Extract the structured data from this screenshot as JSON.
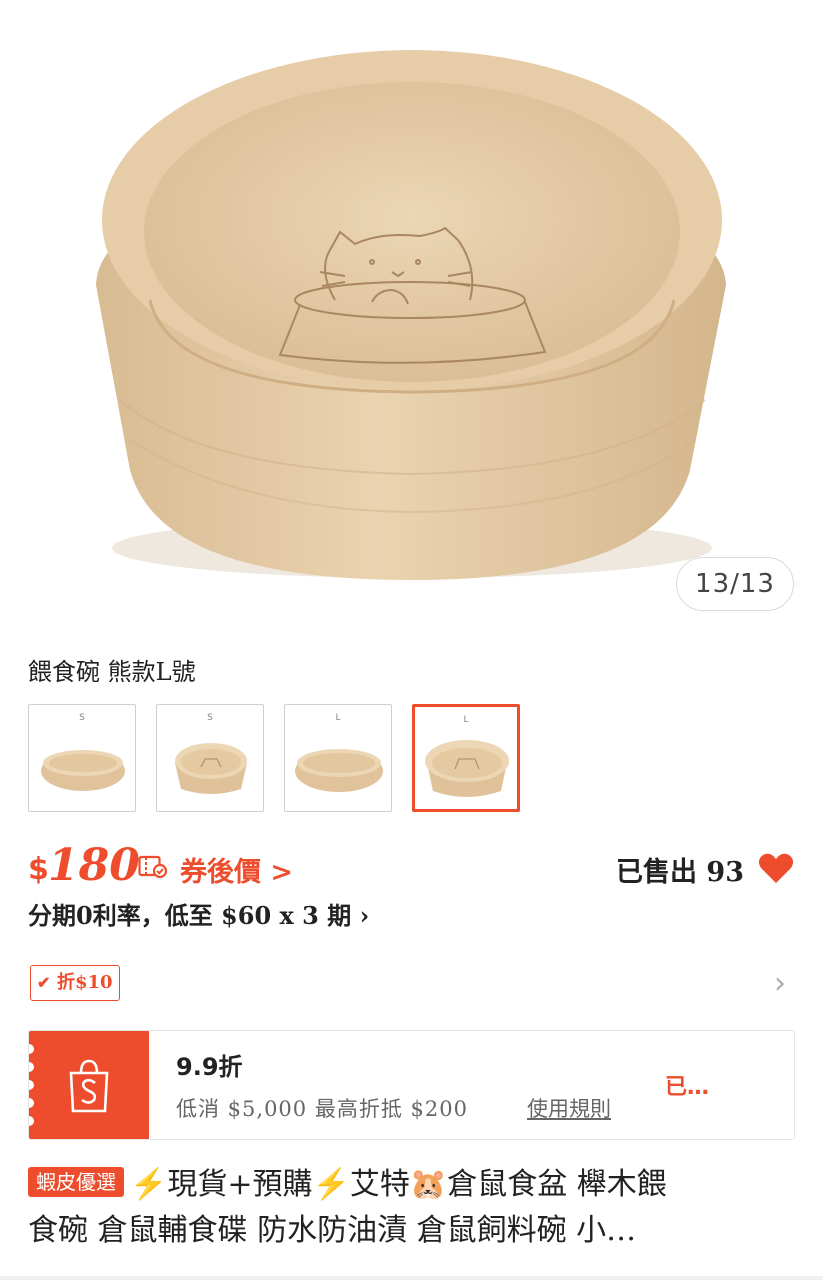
{
  "gallery": {
    "counter": "13/13"
  },
  "variant": {
    "selected_name": "餵食碗 熊款L號",
    "options": [
      {
        "size": "S",
        "style": "plain"
      },
      {
        "size": "S",
        "style": "bear"
      },
      {
        "size": "L",
        "style": "plain"
      },
      {
        "size": "L",
        "style": "bear",
        "selected": true
      }
    ]
  },
  "price": {
    "currency": "$",
    "amount": "180",
    "after_coupon": "券後價 >",
    "sold": "已售出 93"
  },
  "installment": {
    "text": "分期0利率，低至 $60 x 3 期 ›"
  },
  "discount": {
    "tag": "折$10"
  },
  "voucher": {
    "title": "9.9折",
    "condition": "低消 $5,000 最高折抵 $200",
    "rules_link": "使用規則",
    "claimed": "已…"
  },
  "product": {
    "badge": "蝦皮優選",
    "title_line1": "⚡現貨+預購⚡艾特🐹倉鼠食盆 櫸木餵",
    "title_line2": "食碗 倉鼠輔食碟 防水防油漬 倉鼠飼料碗 小…"
  },
  "colors": {
    "accent": "#ee4d2d",
    "wood": "#e3c9a3"
  }
}
